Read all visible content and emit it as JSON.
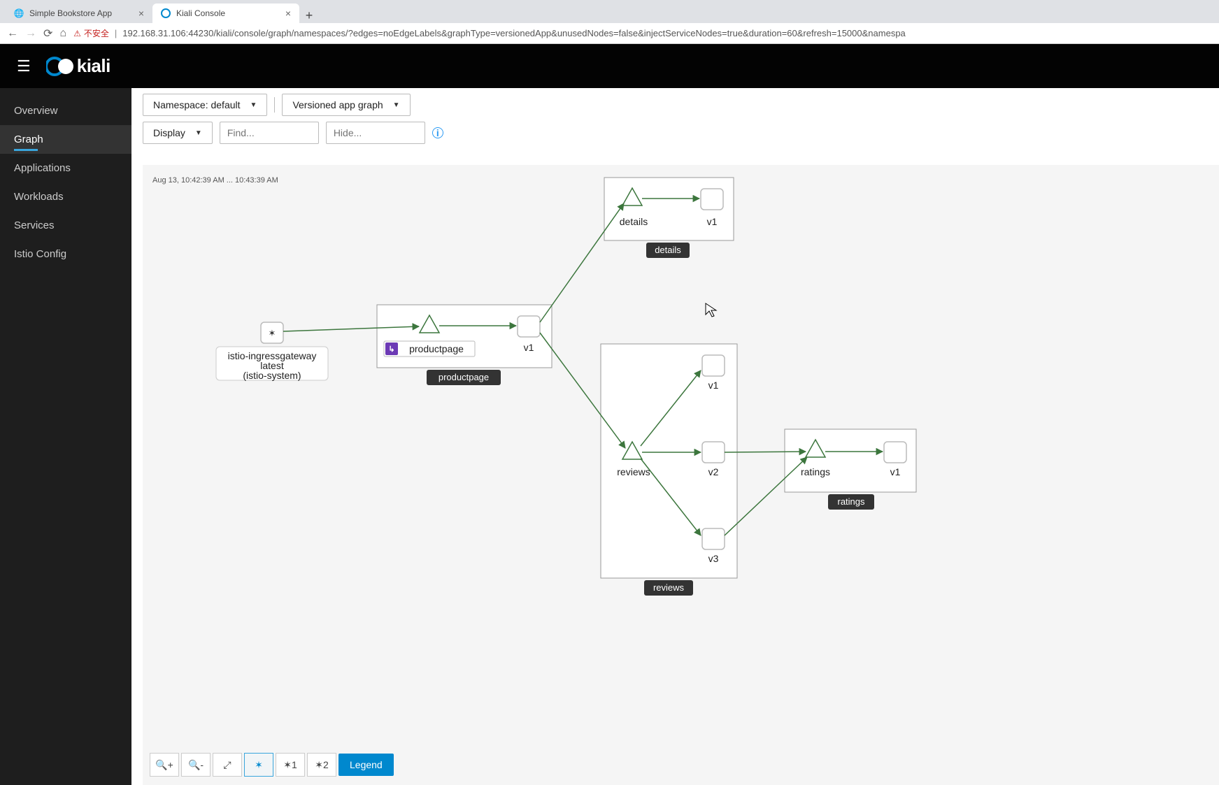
{
  "browser": {
    "tabs": [
      {
        "title": "Simple Bookstore App"
      },
      {
        "title": "Kiali Console"
      }
    ],
    "insecure_label": "不安全",
    "url": "192.168.31.106:44230/kiali/console/graph/namespaces/?edges=noEdgeLabels&graphType=versionedApp&unusedNodes=false&injectServiceNodes=true&duration=60&refresh=15000&namespa"
  },
  "header": {
    "brand": "kiali"
  },
  "sidebar": {
    "items": [
      {
        "label": "Overview"
      },
      {
        "label": "Graph"
      },
      {
        "label": "Applications"
      },
      {
        "label": "Workloads"
      },
      {
        "label": "Services"
      },
      {
        "label": "Istio Config"
      }
    ]
  },
  "toolbar": {
    "namespace_label": "Namespace: default",
    "graph_type_label": "Versioned app graph",
    "display_label": "Display",
    "find_placeholder": "Find...",
    "hide_placeholder": "Hide..."
  },
  "graph": {
    "timestamp": "Aug 13, 10:42:39 AM ... 10:43:39 AM",
    "gateway": {
      "line1": "istio-ingressgateway",
      "line2": "latest",
      "line3": "(istio-system)"
    },
    "productpage": {
      "service": "productpage",
      "version": "v1",
      "group": "productpage"
    },
    "details": {
      "service": "details",
      "version": "v1",
      "group": "details"
    },
    "reviews": {
      "service": "reviews",
      "v1": "v1",
      "v2": "v2",
      "v3": "v3",
      "group": "reviews"
    },
    "ratings": {
      "service": "ratings",
      "version": "v1",
      "group": "ratings"
    }
  },
  "tools": {
    "legend": "Legend",
    "focus1": "1",
    "focus2": "2"
  }
}
